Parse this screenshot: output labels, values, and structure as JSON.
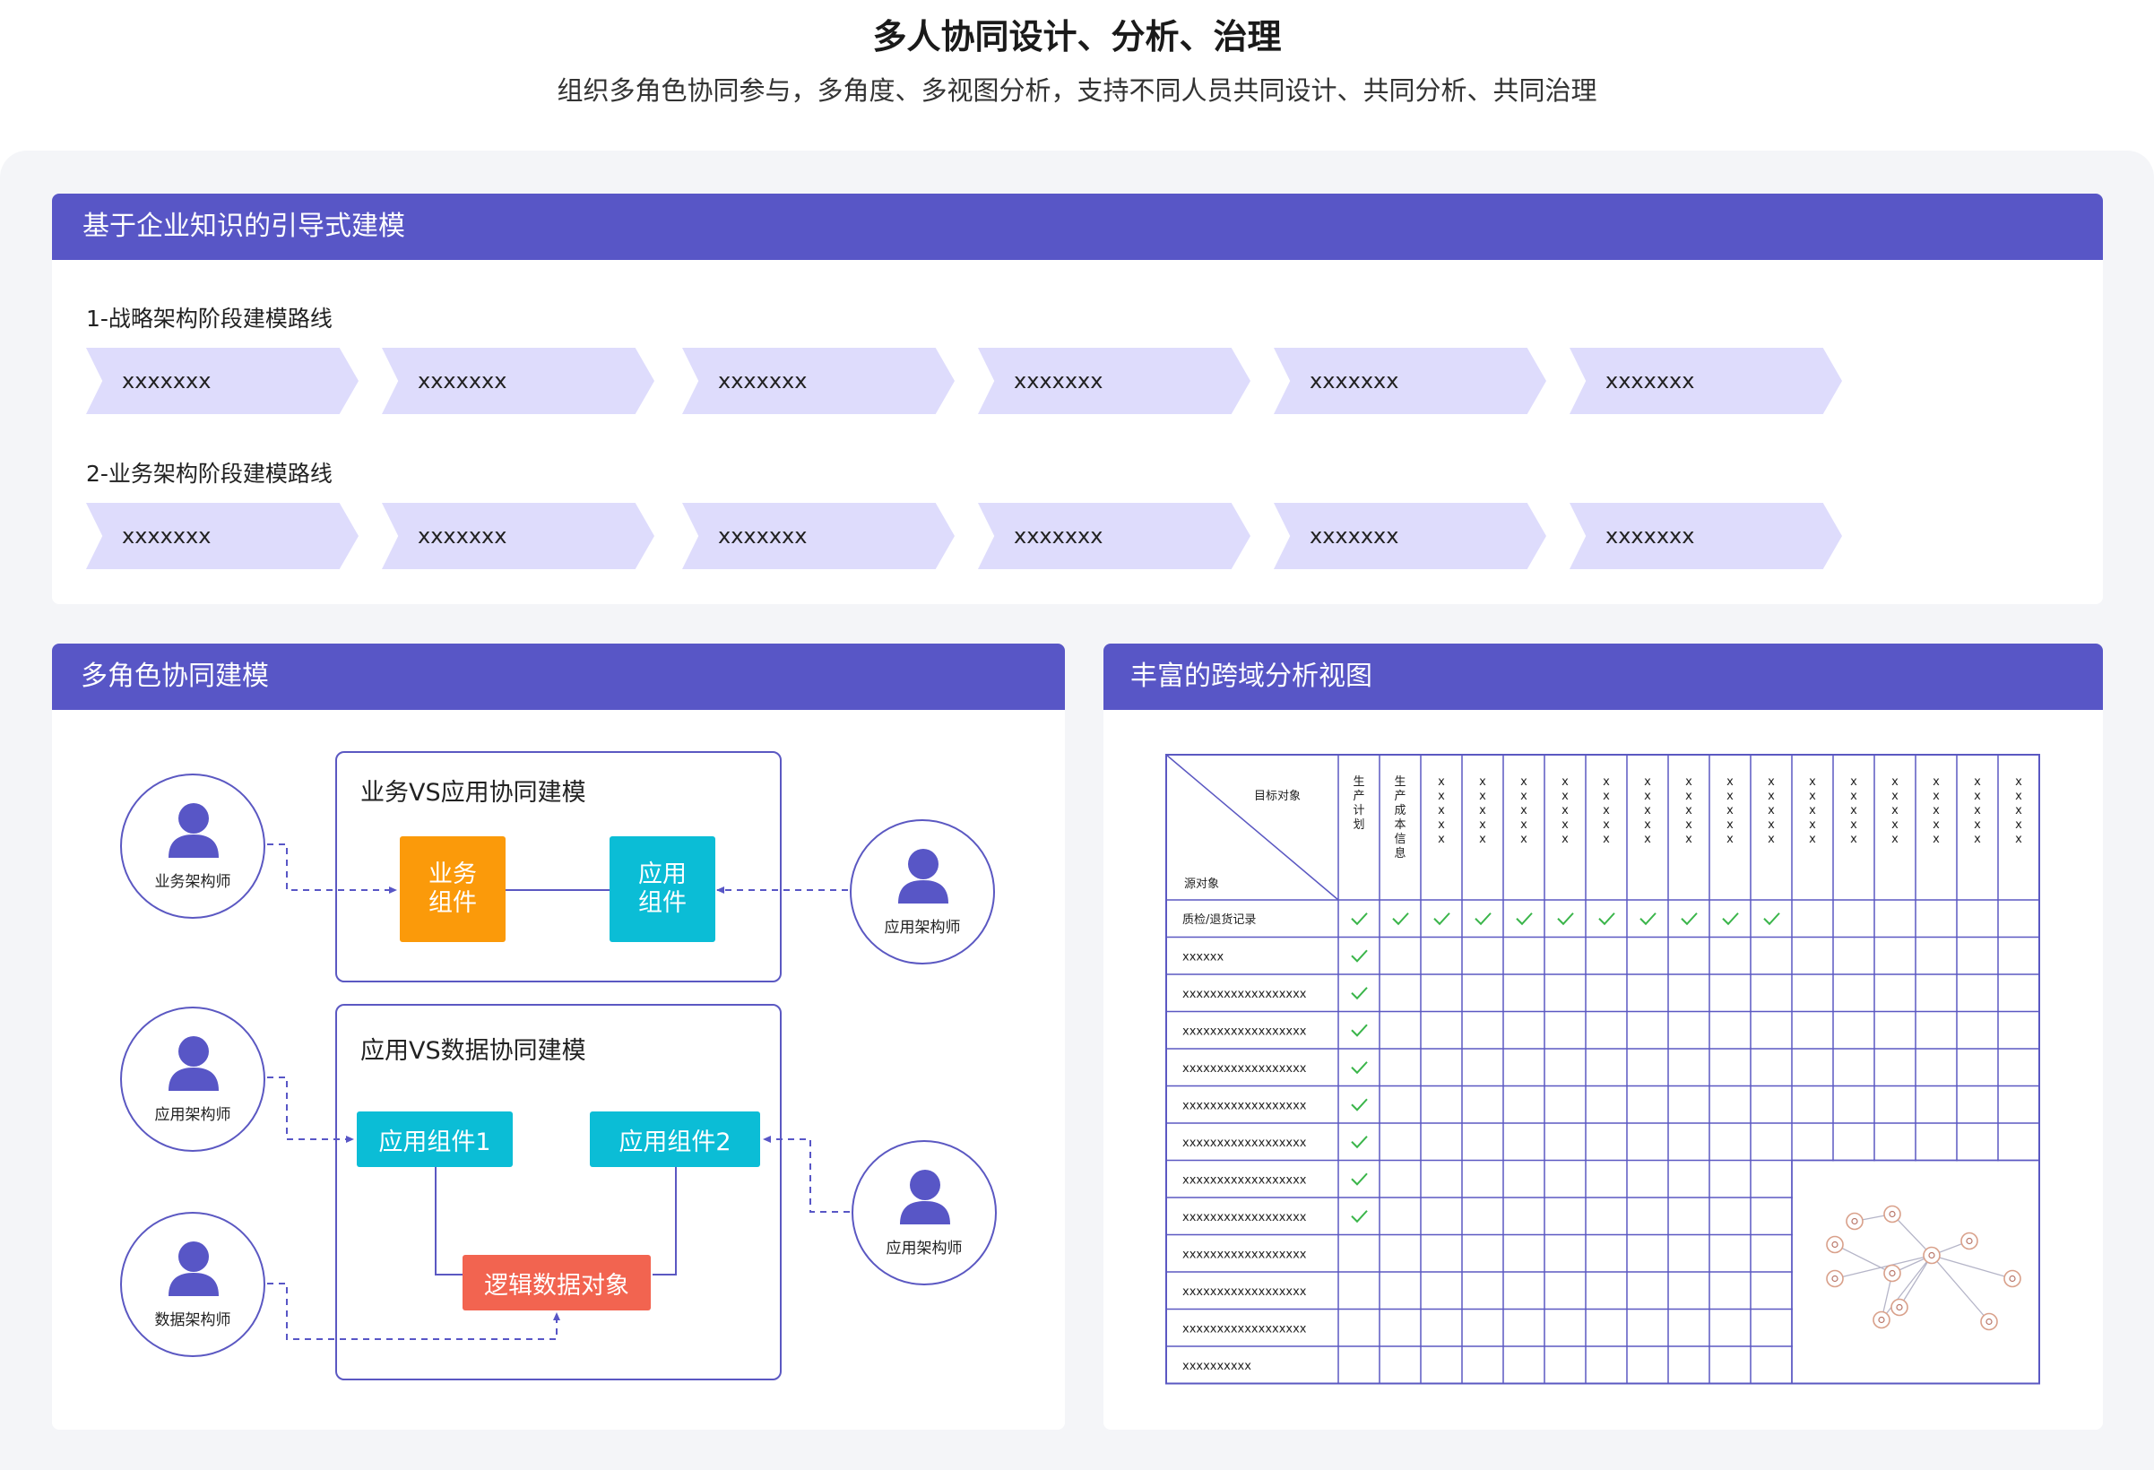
{
  "header": {
    "title": "多人协同设计、分析、治理",
    "subtitle": "组织多角色协同参与，多角度、多视图分析，支持不同人员共同设计、共同分析、共同治理"
  },
  "guided_modeling": {
    "title": "基于企业知识的引导式建模",
    "routes": [
      {
        "title": "1-战略架构阶段建模路线",
        "steps": [
          "xxxxxxx",
          "xxxxxxx",
          "xxxxxxx",
          "xxxxxxx",
          "xxxxxxx",
          "xxxxxxx"
        ]
      },
      {
        "title": "2-业务架构阶段建模路线",
        "steps": [
          "xxxxxxx",
          "xxxxxxx",
          "xxxxxxx",
          "xxxxxxx",
          "xxxxxxx",
          "xxxxxxx"
        ]
      }
    ]
  },
  "collab": {
    "title": "多角色协同建模",
    "group1": {
      "title": "业务VS应用协同建模",
      "left_box": "业务\n组件",
      "right_box": "应用\n组件"
    },
    "group2": {
      "title": "应用VS数据协同建模",
      "box1": "应用组件1",
      "box2": "应用组件2",
      "box3": "逻辑数据对象"
    },
    "roles": {
      "biz_architect": "业务架构师",
      "app_architect_1": "应用架构师",
      "app_architect_2": "应用架构师",
      "app_architect_3": "应用架构师",
      "data_architect": "数据架构师"
    },
    "colors": {
      "biz": "#fb9a0a",
      "app": "#0bbdd6",
      "data": "#f26450",
      "primary": "#5856c6"
    }
  },
  "analysis": {
    "title": "丰富的跨域分析视图",
    "corner_target": "目标对象",
    "corner_source": "源对象",
    "col_headers": [
      "生产计划",
      "生产成本信息",
      "xxxxx",
      "xxxxx",
      "xxxxx",
      "xxxxx",
      "xxxxx",
      "xxxxx",
      "xxxxx",
      "xxxxx",
      "xxxxx",
      "xxxxx",
      "xxxxx",
      "xxxxx",
      "xxxxx",
      "xxxxx",
      "xxxxx"
    ],
    "rows": [
      {
        "label": "质检/退货记录",
        "checks": 11
      },
      {
        "label": "xxxxxx",
        "checks": 1
      },
      {
        "label": "xxxxxxxxxxxxxxxxxx",
        "checks": 1
      },
      {
        "label": "xxxxxxxxxxxxxxxxxx",
        "checks": 1
      },
      {
        "label": "xxxxxxxxxxxxxxxxxx",
        "checks": 1
      },
      {
        "label": "xxxxxxxxxxxxxxxxxx",
        "checks": 1
      },
      {
        "label": "xxxxxxxxxxxxxxxxxx",
        "checks": 1
      },
      {
        "label": "xxxxxxxxxxxxxxxxxx",
        "checks": 1
      },
      {
        "label": "xxxxxxxxxxxxxxxxxx",
        "checks": 1
      },
      {
        "label": "xxxxxxxxxxxxxxxxxx",
        "checks": 0
      },
      {
        "label": "xxxxxxxxxxxxxxxxxx",
        "checks": 0
      },
      {
        "label": "xxxxxxxxxxxxxxxxxx",
        "checks": 0
      },
      {
        "label": "xxxxxxxxxx",
        "checks": 0
      }
    ],
    "colors": {
      "check": "#3ab54a",
      "grid": "#5b58c2"
    }
  }
}
